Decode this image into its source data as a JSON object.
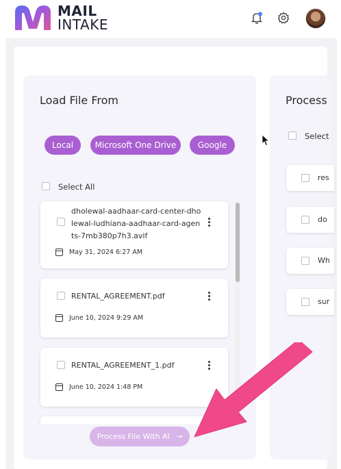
{
  "header": {
    "logo_line1": "MAIL",
    "logo_line2": "INTAKE",
    "icons": [
      "bell-icon",
      "gear-icon",
      "avatar"
    ],
    "bell_dot_color": "#4f7cf6"
  },
  "colors": {
    "chip": "#a95fd1",
    "process_button": "#d8b4e8",
    "card_bg": "#f4f4fa",
    "arrow": "#f0498a"
  },
  "load_panel": {
    "title": "Load File From",
    "sources": [
      "Local",
      "Microsoft One Drive",
      "Google"
    ],
    "select_all": "Select All",
    "files": [
      {
        "name": "dholewal-aadhaar-card-center-dholewal-ludhiana-aadhaar-card-agents-7mb380p7h3.avif",
        "date": "May 31, 2024 6:27 AM"
      },
      {
        "name": "RENTAL_AGREEMENT.pdf",
        "date": "June 10, 2024 9:29 AM"
      },
      {
        "name": "RENTAL_AGREEMENT_1.pdf",
        "date": "June 10, 2024 1:48 PM"
      }
    ],
    "process_button": "Process File With AI"
  },
  "process_panel": {
    "title": "Process",
    "select_all": "Select",
    "rows": [
      "res",
      "do",
      "Wh",
      "sur"
    ]
  }
}
